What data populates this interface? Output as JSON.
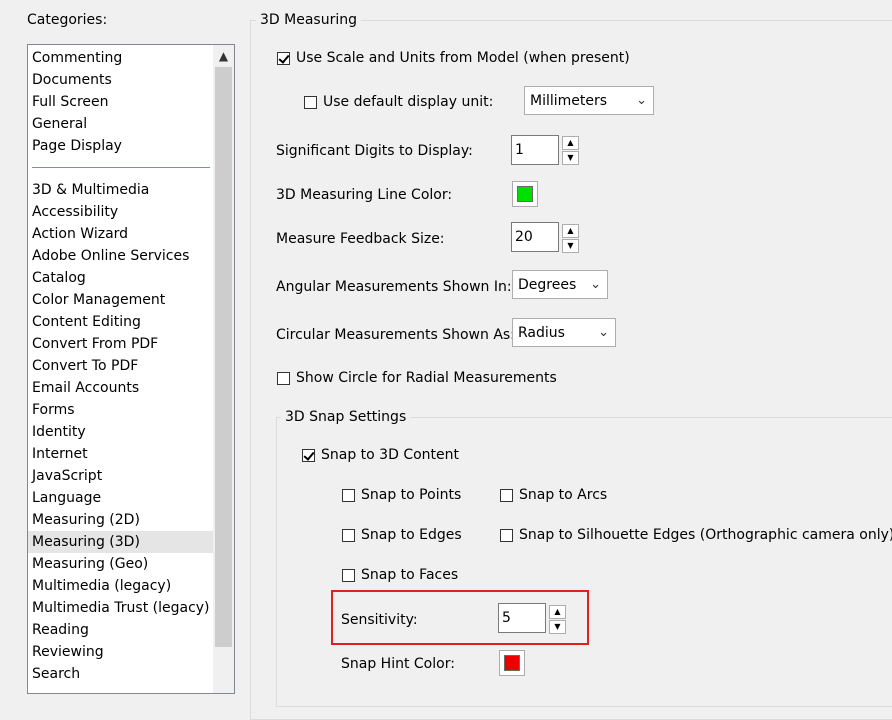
{
  "categories": {
    "label": "Categories:",
    "top_items": [
      "Commenting",
      "Documents",
      "Full Screen",
      "General",
      "Page Display"
    ],
    "items": [
      "3D & Multimedia",
      "Accessibility",
      "Action Wizard",
      "Adobe Online Services",
      "Catalog",
      "Color Management",
      "Content Editing",
      "Convert From PDF",
      "Convert To PDF",
      "Email Accounts",
      "Forms",
      "Identity",
      "Internet",
      "JavaScript",
      "Language",
      "Measuring (2D)",
      "Measuring (3D)",
      "Measuring (Geo)",
      "Multimedia (legacy)",
      "Multimedia Trust (legacy)",
      "Reading",
      "Reviewing",
      "Search"
    ],
    "selected": "Measuring (3D)"
  },
  "measuring": {
    "title": "3D Measuring",
    "use_scale_label": "Use Scale and Units from Model (when present)",
    "use_scale_checked": true,
    "default_unit_label": "Use default display unit:",
    "default_unit_checked": false,
    "default_unit_value": "Millimeters",
    "sig_digits_label": "Significant Digits to Display:",
    "sig_digits_value": "1",
    "line_color_label": "3D Measuring Line Color:",
    "line_color": "#00e000",
    "feedback_label": "Measure Feedback Size:",
    "feedback_value": "20",
    "angular_label": "Angular Measurements Shown In:",
    "angular_value": "Degrees",
    "circular_label": "Circular Measurements Shown As:",
    "circular_value": "Radius",
    "show_circle_label": "Show Circle for Radial Measurements",
    "show_circle_checked": false
  },
  "snap": {
    "title": "3D Snap Settings",
    "snap_content_label": "Snap to 3D Content",
    "snap_content_checked": true,
    "points_label": "Snap to Points",
    "arcs_label": "Snap to Arcs",
    "edges_label": "Snap to Edges",
    "silhouette_label": "Snap to Silhouette Edges (Orthographic camera only)",
    "faces_label": "Snap to Faces",
    "sensitivity_label": "Sensitivity:",
    "sensitivity_value": "5",
    "hint_color_label": "Snap Hint Color:",
    "hint_color": "#ee0000"
  },
  "icons": {
    "check": "check-icon",
    "chevron_down": "chevron-down-icon",
    "spin_up": "▲",
    "spin_down": "▼",
    "scroll_up": "^"
  }
}
